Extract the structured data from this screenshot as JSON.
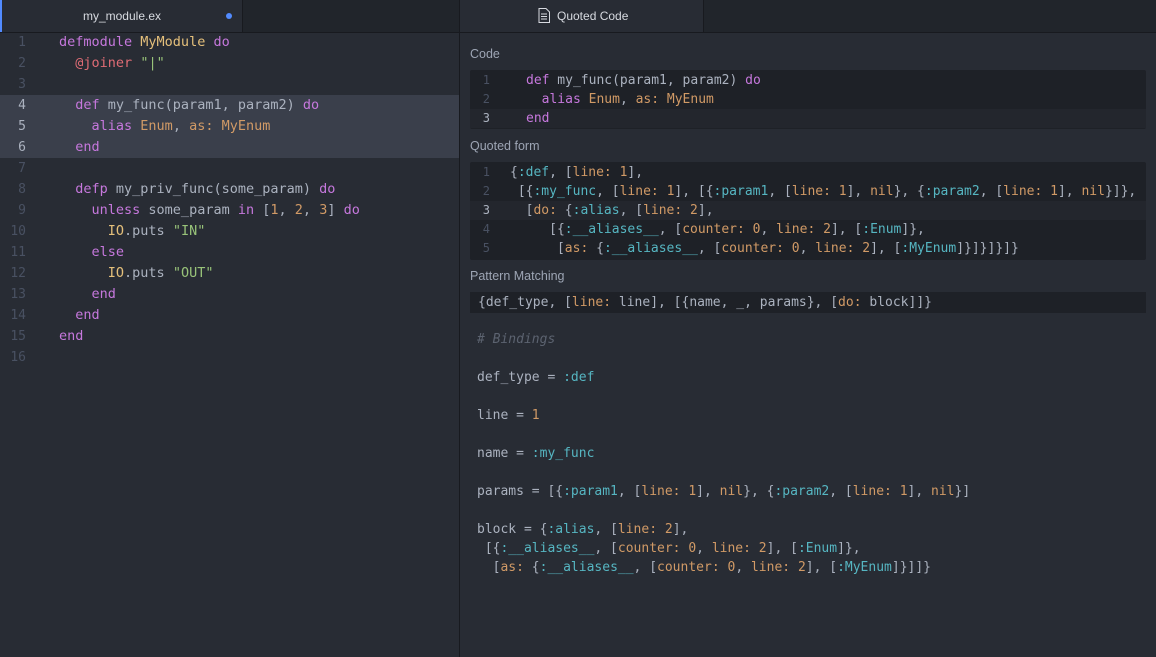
{
  "left_tab": {
    "title": "my_module.ex"
  },
  "right_tab": {
    "title": "Quoted Code"
  },
  "sections": {
    "code": "Code",
    "quoted": "Quoted form",
    "pattern": "Pattern Matching"
  },
  "editor_line_numbers": [
    "1",
    "2",
    "3",
    "4",
    "5",
    "6",
    "7",
    "8",
    "9",
    "10",
    "11",
    "12",
    "13",
    "14",
    "15",
    "16"
  ],
  "code_box_line_numbers": [
    "1",
    "2",
    "3"
  ],
  "quoted_box_line_numbers": [
    "1",
    "2",
    "3",
    "4",
    "5"
  ],
  "colors": {
    "background": "#282c34",
    "tabbar": "#21252b",
    "accent": "#528bff",
    "keyword": "#c678dd",
    "module": "#e5c07b",
    "string": "#98c379",
    "number": "#d19a66",
    "atom": "#56b6c2"
  },
  "icons": {
    "quoted_tab_icon": "file-text-icon",
    "modified_indicator": "dot-icon"
  }
}
